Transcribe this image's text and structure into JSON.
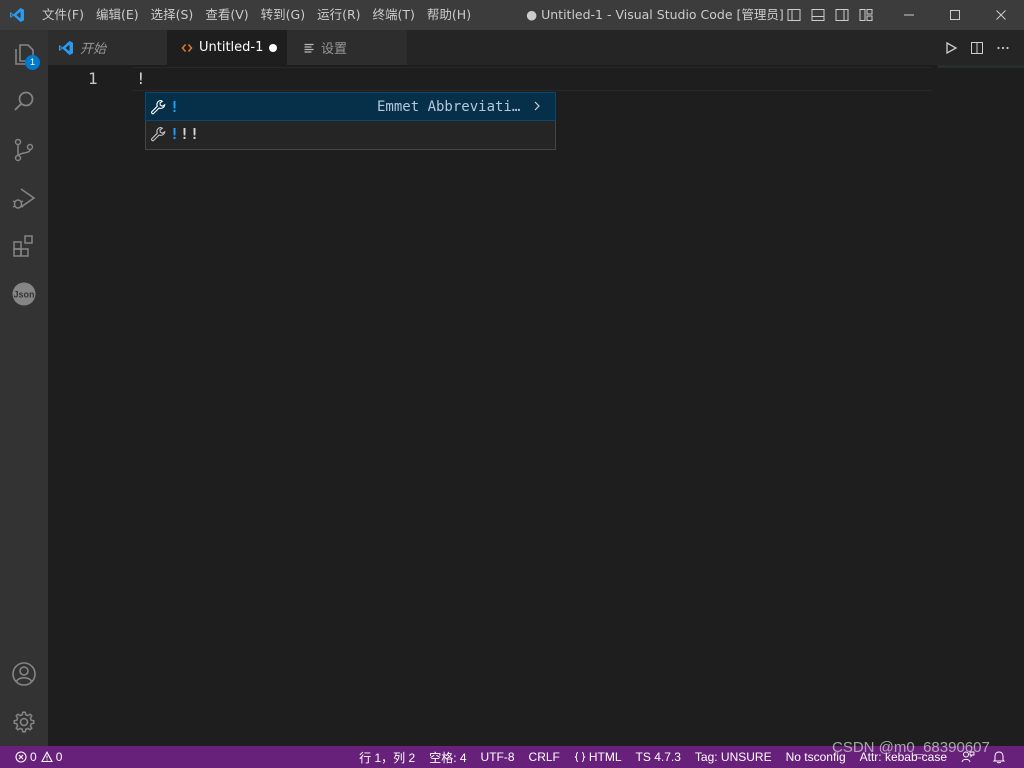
{
  "titlebar": {
    "menu": [
      "文件(F)",
      "编辑(E)",
      "选择(S)",
      "查看(V)",
      "转到(G)",
      "运行(R)",
      "终端(T)",
      "帮助(H)"
    ],
    "window_title": "● Untitled-1 - Visual Studio Code [管理员]"
  },
  "activitybar": {
    "explorer_badge": "1",
    "json_label": "Json"
  },
  "tabs": [
    {
      "label": "开始",
      "icon": "vscode-logo-icon"
    },
    {
      "label": "Untitled-1",
      "icon": "html-brackets-icon",
      "dirty": true,
      "active": true
    },
    {
      "label": "设置",
      "icon": "settings-lines-icon"
    }
  ],
  "editor": {
    "line_number": "1",
    "line_text": "!"
  },
  "suggest": {
    "items": [
      {
        "label": "!",
        "rest": "",
        "detail": "Emmet Abbreviati…",
        "icon": "wrench-icon",
        "selected": true
      },
      {
        "label": "!",
        "rest": "!!",
        "icon": "wrench-icon",
        "selected": false
      }
    ]
  },
  "statusbar": {
    "errors": "0",
    "warnings": "0",
    "position": "行 1，列 2",
    "spaces": "空格: 4",
    "encoding": "UTF-8",
    "eol": "CRLF",
    "language": "HTML",
    "ts_version": "TS 4.7.3",
    "tag": "Tag: UNSURE",
    "tsconfig": "No tsconfig",
    "attr": "Attr: kebab-case"
  },
  "watermark": "CSDN @m0_68390607",
  "colors": {
    "statusbar_bg": "#68217a",
    "accent": "#007acc",
    "suggest_highlight": "#18a3ff"
  }
}
